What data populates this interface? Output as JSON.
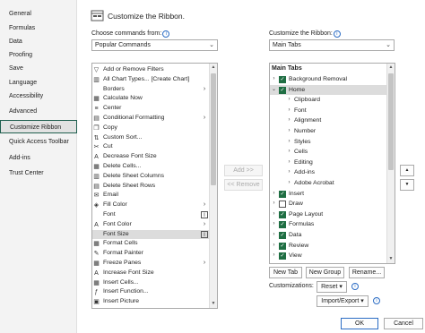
{
  "nav": {
    "items": [
      {
        "label": "General",
        "selected": false
      },
      {
        "label": "Formulas",
        "selected": false
      },
      {
        "label": "Data",
        "selected": false
      },
      {
        "label": "Proofing",
        "selected": false
      },
      {
        "label": "Save",
        "selected": false
      },
      {
        "label": "Language",
        "selected": false
      },
      {
        "label": "Accessibility",
        "selected": false
      },
      {
        "label": "Advanced",
        "selected": false
      },
      {
        "label": "Customize Ribbon",
        "selected": true
      },
      {
        "label": "Quick Access Toolbar",
        "selected": false
      },
      {
        "label": "Add-ins",
        "selected": false
      },
      {
        "label": "Trust Center",
        "selected": false
      }
    ]
  },
  "header": {
    "title": "Customize the Ribbon."
  },
  "commands": {
    "label": "Choose commands from:",
    "source_value": "Popular Commands",
    "items": [
      {
        "label": "Add or Remove Filters",
        "icon": "filter-icon",
        "glyph": "▽",
        "sub": ""
      },
      {
        "label": "All Chart Types... [Create Chart]",
        "icon": "chart-icon",
        "glyph": "▥",
        "sub": ""
      },
      {
        "label": "Borders",
        "icon": "borders-icon",
        "glyph": "",
        "sub": "›"
      },
      {
        "label": "Calculate Now",
        "icon": "calculator-icon",
        "glyph": "▦",
        "sub": ""
      },
      {
        "label": "Center",
        "icon": "align-center-icon",
        "glyph": "≡",
        "sub": ""
      },
      {
        "label": "Conditional Formatting",
        "icon": "conditional-formatting-icon",
        "glyph": "▤",
        "sub": "›"
      },
      {
        "label": "Copy",
        "icon": "copy-icon",
        "glyph": "❐",
        "sub": ""
      },
      {
        "label": "Custom Sort...",
        "icon": "sort-icon",
        "glyph": "⇅",
        "sub": ""
      },
      {
        "label": "Cut",
        "icon": "scissors-icon",
        "glyph": "✂",
        "sub": ""
      },
      {
        "label": "Decrease Font Size",
        "icon": "decrease-font-icon",
        "glyph": "A",
        "sub": ""
      },
      {
        "label": "Delete Cells...",
        "icon": "delete-cells-icon",
        "glyph": "▦",
        "sub": ""
      },
      {
        "label": "Delete Sheet Columns",
        "icon": "delete-columns-icon",
        "glyph": "▥",
        "sub": ""
      },
      {
        "label": "Delete Sheet Rows",
        "icon": "delete-rows-icon",
        "glyph": "▤",
        "sub": ""
      },
      {
        "label": "Email",
        "icon": "email-icon",
        "glyph": "✉",
        "sub": ""
      },
      {
        "label": "Fill Color",
        "icon": "fill-color-icon",
        "glyph": "◈",
        "sub": "›"
      },
      {
        "label": "Font",
        "icon": "font-icon",
        "glyph": "",
        "sub": "I"
      },
      {
        "label": "Font Color",
        "icon": "font-color-icon",
        "glyph": "A",
        "sub": "›"
      },
      {
        "label": "Font Size",
        "icon": "font-size-icon",
        "glyph": "",
        "sub": "I"
      },
      {
        "label": "Format Cells",
        "icon": "format-cells-icon",
        "glyph": "▦",
        "sub": ""
      },
      {
        "label": "Format Painter",
        "icon": "format-painter-icon",
        "glyph": "✎",
        "sub": ""
      },
      {
        "label": "Freeze Panes",
        "icon": "freeze-panes-icon",
        "glyph": "▦",
        "sub": "›"
      },
      {
        "label": "Increase Font Size",
        "icon": "increase-font-icon",
        "glyph": "A",
        "sub": ""
      },
      {
        "label": "Insert Cells...",
        "icon": "insert-cells-icon",
        "glyph": "▦",
        "sub": ""
      },
      {
        "label": "Insert Function...",
        "icon": "function-icon",
        "glyph": "ƒ",
        "sub": ""
      },
      {
        "label": "Insert Picture",
        "icon": "picture-icon",
        "glyph": "▣",
        "sub": ""
      }
    ],
    "highlighted_index": 17
  },
  "buttons": {
    "add": "Add >>",
    "remove": "<< Remove",
    "new_tab": "New Tab",
    "new_group": "New Group",
    "rename": "Rename...",
    "reset": "Reset ▾",
    "import_export": "Import/Export ▾",
    "ok": "OK",
    "cancel": "Cancel",
    "move_up": "▲",
    "move_down": "▼"
  },
  "ribbon": {
    "label": "Customize the Ribbon:",
    "source_value": "Main Tabs",
    "header": "Main Tabs",
    "items": [
      {
        "label": "Background Removal",
        "level": 0,
        "toggle": "›",
        "checked": true
      },
      {
        "label": "Home",
        "level": 0,
        "toggle": "⌄",
        "checked": true,
        "highlight": true
      },
      {
        "label": "Clipboard",
        "level": 1,
        "toggle": "›",
        "checked": null
      },
      {
        "label": "Font",
        "level": 1,
        "toggle": "›",
        "checked": null
      },
      {
        "label": "Alignment",
        "level": 1,
        "toggle": "›",
        "checked": null
      },
      {
        "label": "Number",
        "level": 1,
        "toggle": "›",
        "checked": null
      },
      {
        "label": "Styles",
        "level": 1,
        "toggle": "›",
        "checked": null
      },
      {
        "label": "Cells",
        "level": 1,
        "toggle": "›",
        "checked": null
      },
      {
        "label": "Editing",
        "level": 1,
        "toggle": "›",
        "checked": null
      },
      {
        "label": "Add-ins",
        "level": 1,
        "toggle": "›",
        "checked": null
      },
      {
        "label": "Adobe Acrobat",
        "level": 1,
        "toggle": "›",
        "checked": null
      },
      {
        "label": "Insert",
        "level": 0,
        "toggle": "›",
        "checked": true
      },
      {
        "label": "Draw",
        "level": 0,
        "toggle": "›",
        "checked": false
      },
      {
        "label": "Page Layout",
        "level": 0,
        "toggle": "›",
        "checked": true
      },
      {
        "label": "Formulas",
        "level": 0,
        "toggle": "›",
        "checked": true
      },
      {
        "label": "Data",
        "level": 0,
        "toggle": "›",
        "checked": true
      },
      {
        "label": "Review",
        "level": 0,
        "toggle": "›",
        "checked": true
      },
      {
        "label": "View",
        "level": 0,
        "toggle": "›",
        "checked": true
      }
    ]
  },
  "customizations": {
    "label": "Customizations:"
  },
  "info_glyph": "i",
  "checkmark": "✓",
  "dropdown_arrow": "⌄",
  "scroll_up": "▲",
  "scroll_down": "▼",
  "colors": {
    "accent_green": "#1f6e43",
    "nav_border": "#1f5e4e",
    "info_blue": "#2b6cc4"
  }
}
